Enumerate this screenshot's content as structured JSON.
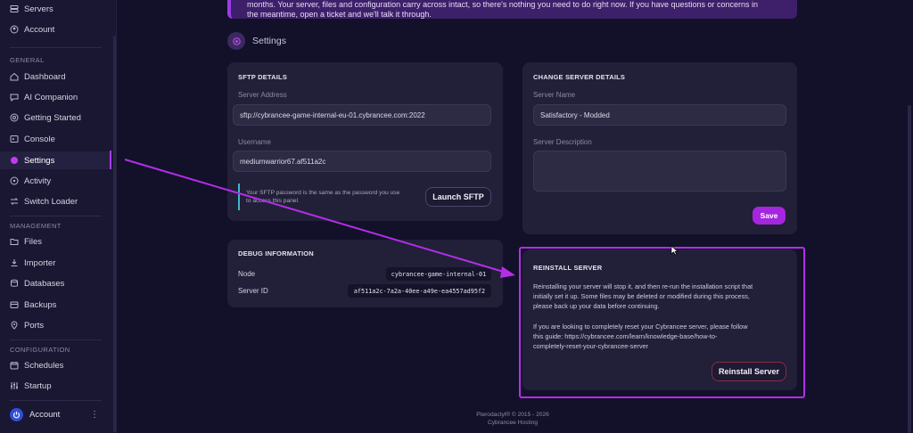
{
  "sidebar": {
    "top_items": [
      {
        "label": "Servers",
        "icon": "servers-icon"
      },
      {
        "label": "Account",
        "icon": "account-icon"
      }
    ],
    "sections": [
      {
        "label": "GENERAL",
        "items": [
          {
            "label": "Dashboard",
            "icon": "dashboard-icon"
          },
          {
            "label": "AI Companion",
            "icon": "chat-icon"
          },
          {
            "label": "Getting Started",
            "icon": "help-icon"
          },
          {
            "label": "Console",
            "icon": "terminal-icon"
          },
          {
            "label": "Settings",
            "icon": "settings-dot-icon",
            "active": true
          },
          {
            "label": "Activity",
            "icon": "activity-icon"
          },
          {
            "label": "Switch Loader",
            "icon": "switch-icon"
          }
        ]
      },
      {
        "label": "MANAGEMENT",
        "items": [
          {
            "label": "Files",
            "icon": "folder-icon"
          },
          {
            "label": "Importer",
            "icon": "import-icon"
          },
          {
            "label": "Databases",
            "icon": "database-icon"
          },
          {
            "label": "Backups",
            "icon": "backup-icon"
          },
          {
            "label": "Ports",
            "icon": "location-icon"
          }
        ]
      },
      {
        "label": "CONFIGURATION",
        "items": [
          {
            "label": "Schedules",
            "icon": "calendar-icon"
          },
          {
            "label": "Startup",
            "icon": "sliders-icon"
          }
        ]
      }
    ],
    "account_label": "Account"
  },
  "banner": {
    "line1": "months. Your server, files and configuration carry across intact, so there's nothing you need to do right now. If you have questions or concerns in",
    "line2": "the meantime, open a ticket and we'll talk it through."
  },
  "page_title": "Settings",
  "sftp": {
    "title": "SFTP DETAILS",
    "server_address_label": "Server Address",
    "server_address_value": "sftp://cybrancee-game-internal-eu-01.cybrancee.com:2022",
    "username_label": "Username",
    "username_value": "mediumwarrior67.af511a2c",
    "note_line1": "Your SFTP password is the same as the password you use",
    "note_line2": "to access this panel.",
    "launch_label": "Launch SFTP"
  },
  "change_details": {
    "title": "CHANGE SERVER DETAILS",
    "name_label": "Server Name",
    "name_value": "Satisfactory - Modded",
    "description_label": "Server Description",
    "description_value": "",
    "save_label": "Save"
  },
  "debug": {
    "title": "DEBUG INFORMATION",
    "node_label": "Node",
    "node_value": "cybrancee-game-internal-01",
    "server_id_label": "Server ID",
    "server_id_value": "af511a2c-7a2a-40ee-a49e-ea4557ad95f2"
  },
  "reinstall": {
    "title": "REINSTALL SERVER",
    "para1_line1": "Reinstalling your server will stop it, and then re-run the installation script that",
    "para1_line2": "initially set it up. Some files may be deleted or modified during this process,",
    "para1_line3": "please back up your data before continuing.",
    "para2_line1": "If you are looking to completely reset your Cybrancee server, please follow",
    "para2_line2": "this guide: https://cybrancee.com/learn/knowledge-base/how-to-",
    "para2_line3": "completely-reset-your-cybrancee-server",
    "button_label": "Reinstall Server"
  },
  "footer": {
    "line1": "Pterodactyl® © 2015 - 2026",
    "line2": "Cybrancee Hosting"
  },
  "colors": {
    "accent": "#a526df",
    "highlight": "#b32ee8",
    "background": "#13102a",
    "card": "#221f38"
  }
}
